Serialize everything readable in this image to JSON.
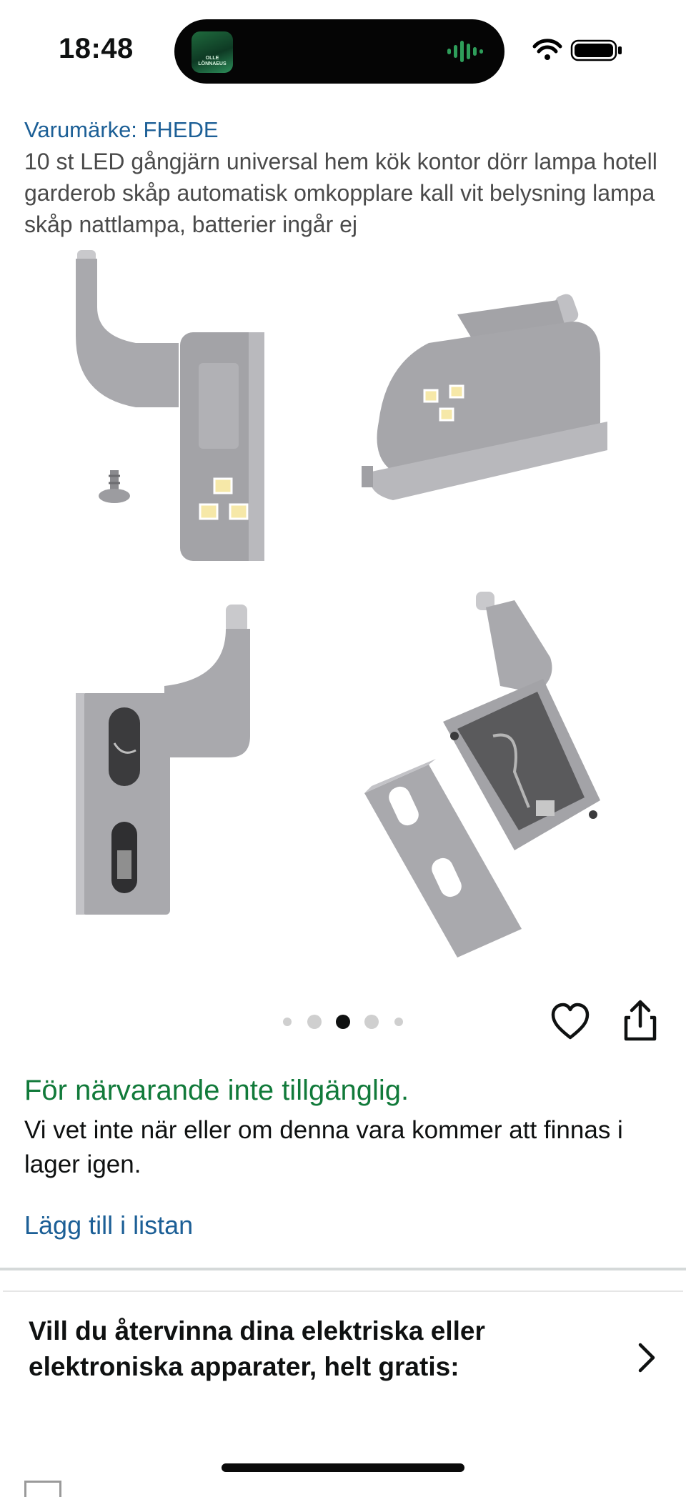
{
  "status_bar": {
    "time": "18:48",
    "island_thumb_text": "OLLE LÖNNAEUS",
    "wifi_icon": "wifi-icon",
    "battery_icon": "battery-icon"
  },
  "product": {
    "brand": "Varumärke: FHEDE",
    "title": "10 st LED gångjärn universal hem kök kontor dörr lampa hotell garderob skåp automatisk omkopplare kall vit belysning lampa skåp nattlampa, batterier ingår ej"
  },
  "carousel": {
    "total": 5,
    "active_index": 2
  },
  "actions": {
    "favorite_icon": "heart-icon",
    "share_icon": "share-icon"
  },
  "availability": {
    "status": "För närvarande inte tillgänglig.",
    "note": "Vi vet inte när eller om denna vara kommer att finnas i lager igen."
  },
  "list": {
    "add_label": "Lägg till i listan"
  },
  "recycle": {
    "label": "Vill du återvinna dina elektriska eller elektroniska apparater, helt gratis:",
    "chevron_icon": "chevron-right-icon"
  },
  "colors": {
    "link": "#1c5f96",
    "availability": "#117a3a",
    "text": "#0f1111"
  }
}
